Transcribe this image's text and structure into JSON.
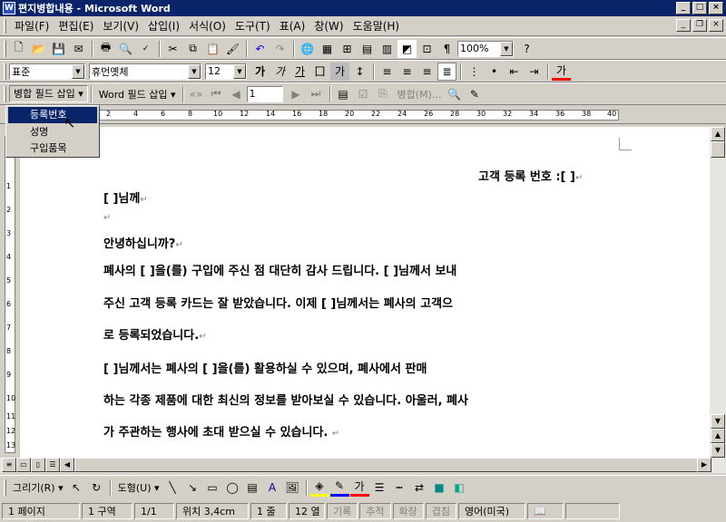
{
  "window": {
    "title": "편지병합내용 - Microsoft Word",
    "icon": "word-doc-icon"
  },
  "menu": {
    "items": [
      "파일(F)",
      "편집(E)",
      "보기(V)",
      "삽입(I)",
      "서식(O)",
      "도구(T)",
      "표(A)",
      "창(W)",
      "도움말(H)"
    ]
  },
  "standard_toolbar": {
    "zoom": "100%"
  },
  "format_toolbar": {
    "style": "표준",
    "font": "휴먼옛체",
    "size": "12"
  },
  "mailmerge_toolbar": {
    "merge_field_label": "병합 필드 삽입",
    "word_field_label": "Word 필드 삽입",
    "record_value": "1",
    "merge_label": "병합(M)..."
  },
  "merge_dropdown": {
    "items": [
      "등록번호",
      "성명",
      "구입품목"
    ],
    "selected_index": 0
  },
  "ruler": {
    "numbers": [
      "2",
      "4",
      "6",
      "8",
      "10",
      "12",
      "14",
      "16",
      "18",
      "20",
      "22",
      "24",
      "26",
      "28",
      "30",
      "32",
      "34",
      "36",
      "38",
      "40"
    ]
  },
  "vruler": {
    "numbers": [
      "1",
      "2",
      "3",
      "4",
      "5",
      "6",
      "7",
      "8",
      "9",
      "10",
      "11",
      "12",
      "13"
    ]
  },
  "document": {
    "customer_line": "고객 등록 번호 :[  ]",
    "name_line": "[    ]님께",
    "greeting": "안녕하십니까?",
    "p1_l1": "폐사의 [    ]을(를) 구입에 주신 점 대단히 감사 드립니다. [    ]님께서 보내",
    "p1_l2": "주신 고객 등록 카드는 잘 받았습니다.  이제 [    ]님께서는 폐사의 고객으",
    "p1_l3": "로 등록되었습니다.",
    "p2_l1": "[      ]님께서는 폐사의 [      ]을(를)  활용하실 수 있으며,  폐사에서 판매",
    "p2_l2": "하는 각종 제품에 대한 최신의 정보를 받아보실 수 있습니다.  아울러, 폐사",
    "p2_l3": "가 주관하는 행사에 초대 받으실 수 있습니다."
  },
  "draw_toolbar": {
    "draw_label": "그리기(R)",
    "shapes_label": "도형(U)"
  },
  "status": {
    "page": "1 페이지",
    "section": "1 구역",
    "pages": "1/1",
    "position": "위치 3,4cm",
    "line": "1 줄",
    "col": "12 열",
    "rec": "기록",
    "trk": "추적",
    "ext": "확장",
    "ovr": "겹침",
    "lang": "영어(미국)"
  }
}
